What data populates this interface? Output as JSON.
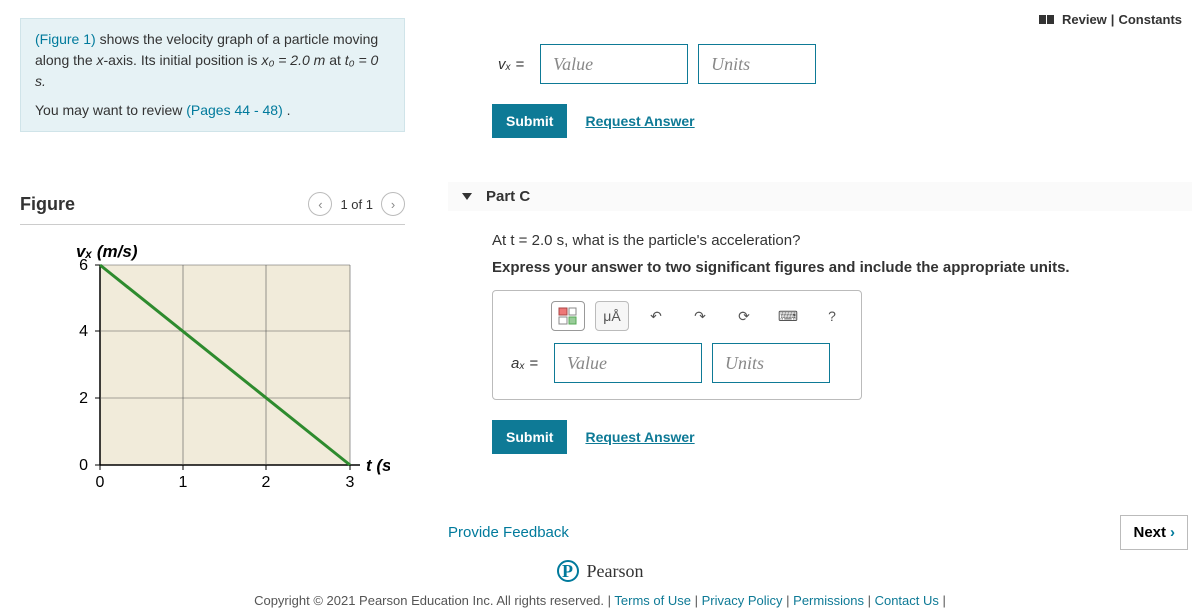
{
  "topLinks": {
    "review": "Review",
    "constants": "Constants"
  },
  "intro": {
    "line1a": "(Figure 1)",
    "line1b": " shows the velocity graph of a particle moving along the ",
    "xaxis": "x",
    "line1c": "-axis. Its initial position is ",
    "x0": "x₀ = 2.0 m",
    "line1d": " at ",
    "t0": "t₀ = 0 s.",
    "line2": "You may want to review ",
    "pages": "(Pages 44 - 48)",
    "dot": " ."
  },
  "figure": {
    "title": "Figure",
    "pager": "1 of 1"
  },
  "chart_data": {
    "type": "line",
    "title": "",
    "xlabel": "t (s)",
    "ylabel": "vₓ (m/s)",
    "x": [
      0,
      3
    ],
    "y": [
      6,
      0
    ],
    "xlim": [
      0,
      3.3
    ],
    "ylim": [
      0,
      6.5
    ],
    "xticks": [
      0,
      1,
      2,
      3
    ],
    "yticks": [
      0,
      2,
      4,
      6
    ]
  },
  "partB": {
    "var": "vₓ =",
    "valuePh": "Value",
    "unitsPh": "Units",
    "submit": "Submit",
    "request": "Request Answer"
  },
  "partC": {
    "title": "Part C",
    "question": "At t = 2.0 s, what is the particle's acceleration?",
    "instr": "Express your answer to two significant figures and include the appropriate units.",
    "muA": "μÅ",
    "help": "?",
    "var": "aₓ =",
    "valuePh": "Value",
    "unitsPh": "Units",
    "submit": "Submit",
    "request": "Request Answer"
  },
  "feedback": "Provide Feedback",
  "next": "Next",
  "pearson": "Pearson",
  "footer": {
    "copy": "Copyright © 2021 Pearson Education Inc. All rights reserved.",
    "terms": "Terms of Use",
    "privacy": "Privacy Policy",
    "perms": "Permissions",
    "contact": "Contact Us",
    "sep": " | "
  }
}
